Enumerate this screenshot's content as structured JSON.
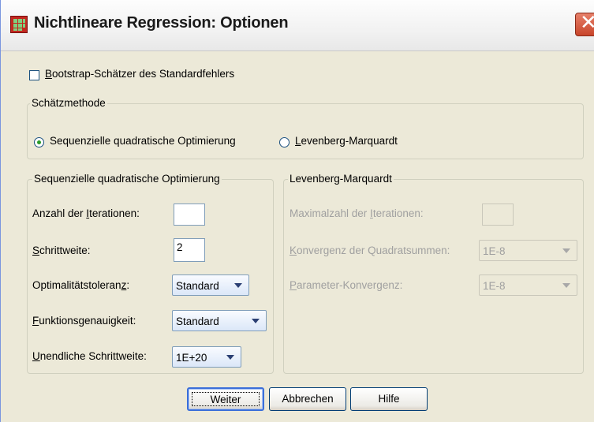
{
  "window": {
    "title": "Nichtlineare Regression: Optionen"
  },
  "bootstrap": {
    "label_first": "B",
    "label_rest": "ootstrap-Schätzer des Standardfehlers",
    "checked": false
  },
  "method_group": {
    "legend": "Schätzmethode",
    "sqp_label": "Sequenzielle quadratische Optimierung",
    "lm_label_first": "L",
    "lm_label_rest": "evenberg-Marquardt",
    "selected": "sqp"
  },
  "sqp_group": {
    "legend": "Sequenzielle quadratische Optimierung",
    "iterations_prefix": "Anzahl der ",
    "iterations_key": "I",
    "iterations_suffix": "terationen:",
    "iterations_value": "",
    "step_key": "S",
    "step_suffix": "chrittweite:",
    "step_value": "2",
    "opt_tol_prefix": "Optimalitätstoleran",
    "opt_tol_key": "z",
    "opt_tol_suffix": ":",
    "opt_tol_value": "Standard",
    "func_key": "F",
    "func_suffix": "unktionsgenauigkeit:",
    "func_value": "Standard",
    "inf_key": "U",
    "inf_suffix": "nendliche Schrittweite:",
    "inf_value": "1E+20"
  },
  "lm_group": {
    "legend": "Levenberg-Marquardt",
    "maxiter_prefix": "Maximalzahl der ",
    "maxiter_key": "I",
    "maxiter_suffix": "terationen:",
    "maxiter_value": "",
    "sscon_key": "K",
    "sscon_suffix": "onvergenz der Quadratsummen:",
    "sscon_value": "1E-8",
    "pcon_key": "P",
    "pcon_suffix": "arameter-Konvergenz:",
    "pcon_value": "1E-8"
  },
  "buttons": {
    "continue": "Weiter",
    "cancel": "Abbrechen",
    "help": "Hilfe"
  },
  "colors": {
    "window_bg": "#ece9d8",
    "close_button": "#c8452a",
    "radio_selected": "#2a9b2a",
    "default_button_border": "#3b6fd9"
  },
  "icons": {
    "app": "spss-table-icon",
    "close": "close-icon"
  }
}
